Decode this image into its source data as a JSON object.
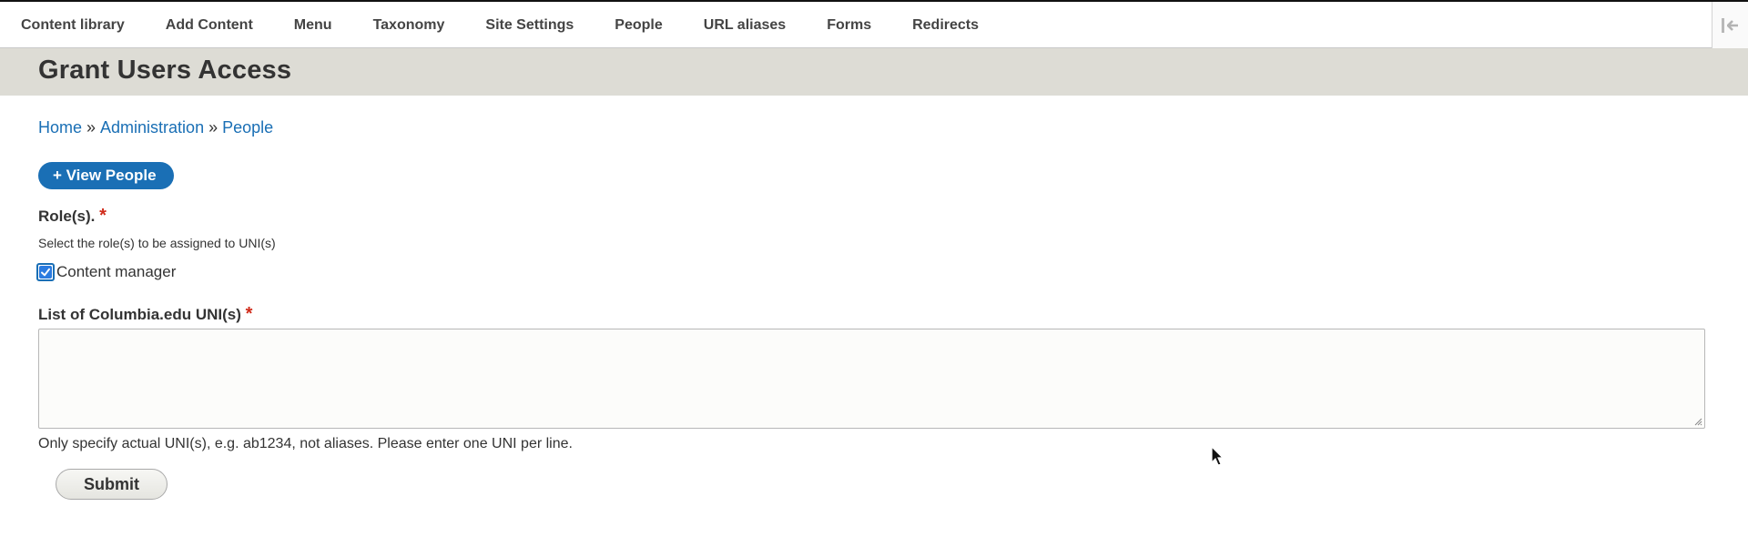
{
  "toolbar": {
    "items": [
      "Content library",
      "Add Content",
      "Menu",
      "Taxonomy",
      "Site Settings",
      "People",
      "URL aliases",
      "Forms",
      "Redirects"
    ],
    "collapse_icon": "collapse-arrow-icon"
  },
  "page": {
    "title": "Grant Users Access"
  },
  "breadcrumb": {
    "items": [
      "Home",
      "Administration",
      "People"
    ],
    "separator": "»"
  },
  "actions": {
    "view_people": "+ View People"
  },
  "form": {
    "roles": {
      "label": "Role(s).",
      "required_mark": "*",
      "description": "Select the role(s) to be assigned to UNI(s)",
      "options": [
        {
          "label": "Content manager",
          "checked": true
        }
      ]
    },
    "unis": {
      "label": "List of Columbia.edu UNI(s)",
      "required_mark": "*",
      "value": "",
      "description": "Only specify actual UNI(s), e.g. ab1234, not aliases. Please enter one UNI per line."
    },
    "submit_label": "Submit"
  },
  "colors": {
    "link": "#1a6fb5",
    "title_band": "#dddcd5",
    "required": "#d02b1a"
  }
}
